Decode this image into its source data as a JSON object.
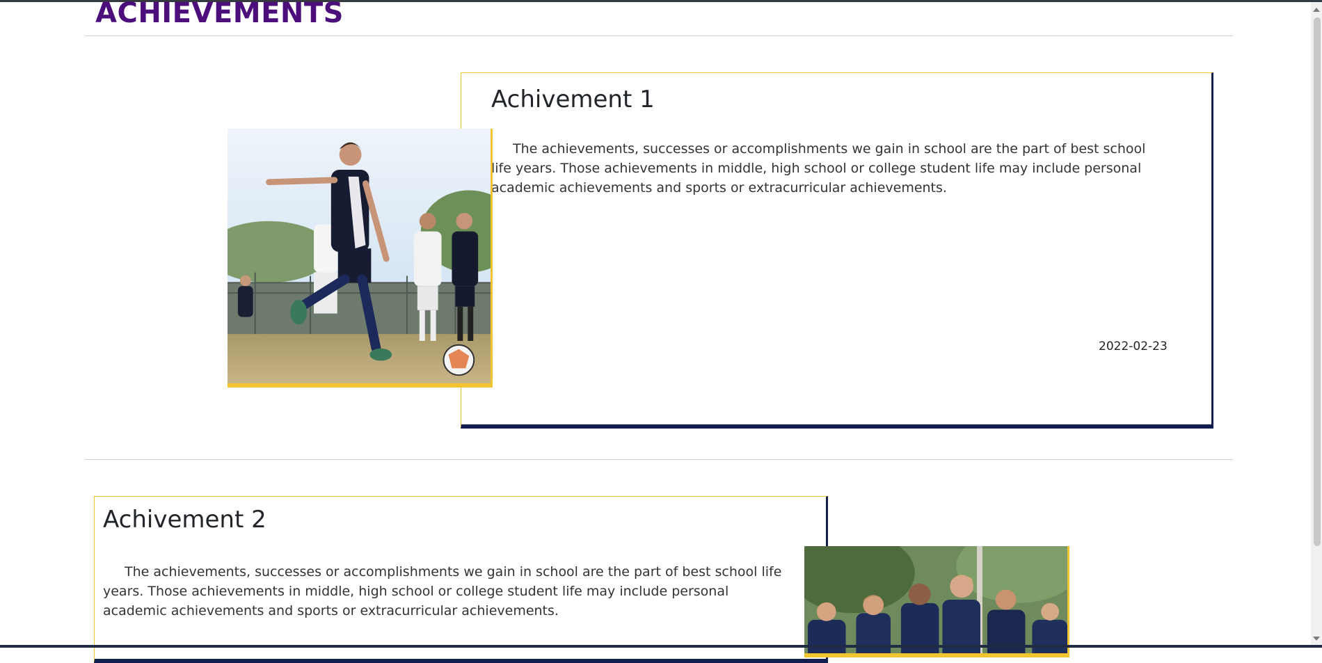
{
  "page": {
    "title": "ACHIEVEMENTS"
  },
  "achievements": [
    {
      "title": "Achivement 1",
      "description": "The achievements, successes or accomplishments we gain in school are the part of best school life years. Those achievements in middle, high school or college student life may include personal academic achievements and sports or extracurricular achievements.",
      "date": "2022-02-23",
      "image": "soccer-player-kicking-ball-photo"
    },
    {
      "title": "Achivement 2",
      "description": "The achievements, successes or accomplishments we gain in school are the part of best school life years. Those achievements in middle, high school or college student life may include personal academic achievements and sports or extracurricular achievements.",
      "image": "team-celebrating-photo"
    }
  ],
  "colors": {
    "title": "#4b0e7a",
    "accent_yellow": "#f4c430",
    "accent_navy": "#121e4d"
  }
}
